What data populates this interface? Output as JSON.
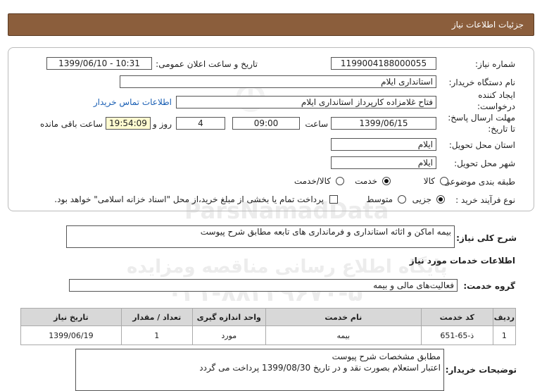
{
  "header": {
    "title": "جزئیات اطلاعات نیاز"
  },
  "watermark": {
    "lines": [
      "ParsNamadData",
      "مرکز فراوری اطلاعات پارس نماد داده ها",
      "پایگاه اطلاع رسانی مناقصه ومزایده",
      "۰۲۱-۸۸۳۴۹۶۷۰-۵"
    ]
  },
  "form": {
    "need_number_label": "شماره نیاز:",
    "need_number": "1199004188000055",
    "announce_label": "تاریخ و ساعت اعلان عمومی:",
    "announce_value": "1399/06/10 - 10:31",
    "buyer_org_label": "نام دستگاه خریدار:",
    "buyer_org": "استانداری ایلام",
    "creator_label_1": "ایجاد کننده",
    "creator_label_2": "درخواست:",
    "creator": "فتاح غلامزاده کارپرداز استانداری ایلام",
    "contact_link": "اطلاعات تماس خریدار",
    "deadline_label_1": "مهلت ارسال پاسخ:",
    "deadline_label_2": "تا تاریخ:",
    "deadline_date": "1399/06/15",
    "time_label": "ساعت",
    "deadline_time": "09:00",
    "days_value": "4",
    "days_label": "روز و",
    "remaining_time": "19:54:09",
    "remaining_label": "ساعت باقی مانده",
    "province_label": "استان محل تحویل:",
    "province": "ایلام",
    "city_label": "شهر محل تحویل:",
    "city": "ایلام",
    "category_label": "طبقه بندی موضوعی:",
    "category_options": [
      "کالا",
      "خدمت",
      "کالا/خدمت"
    ],
    "category_selected": "خدمت",
    "process_label": "نوع فرآیند خرید :",
    "process_options": [
      "جزیی",
      "متوسط"
    ],
    "process_selected": "جزیی",
    "payment_note": "پرداخت تمام یا بخشی از مبلغ خرید،از محل \"اسناد خزانه اسلامی\" خواهد بود."
  },
  "summary": {
    "label": "شرح کلی نیاز:",
    "value": "بیمه اماکن و اثاثه استانداری و فرمانداری های تابعه مطابق شرح پیوست"
  },
  "services": {
    "section_title": "اطلاعات خدمات مورد نیاز",
    "group_label": "گروه خدمت:",
    "group_value": "فعالیت‌های مالی و بیمه",
    "columns": [
      "ردیف",
      "کد خدمت",
      "نام خدمت",
      "واحد اندازه گیری",
      "تعداد / مقدار",
      "تاریخ نیاز"
    ],
    "rows": [
      [
        "1",
        "ذ-65-651",
        "بیمه",
        "مورد",
        "1",
        "1399/06/19"
      ]
    ]
  },
  "buyer_notes": {
    "label": "توضیحات خریدار:",
    "line1": "مطابق مشخصات شرح پیوست",
    "line2": "اعتبار استعلام بصورت نقد و در تاریخ 1399/08/30 پرداخت می گردد"
  }
}
